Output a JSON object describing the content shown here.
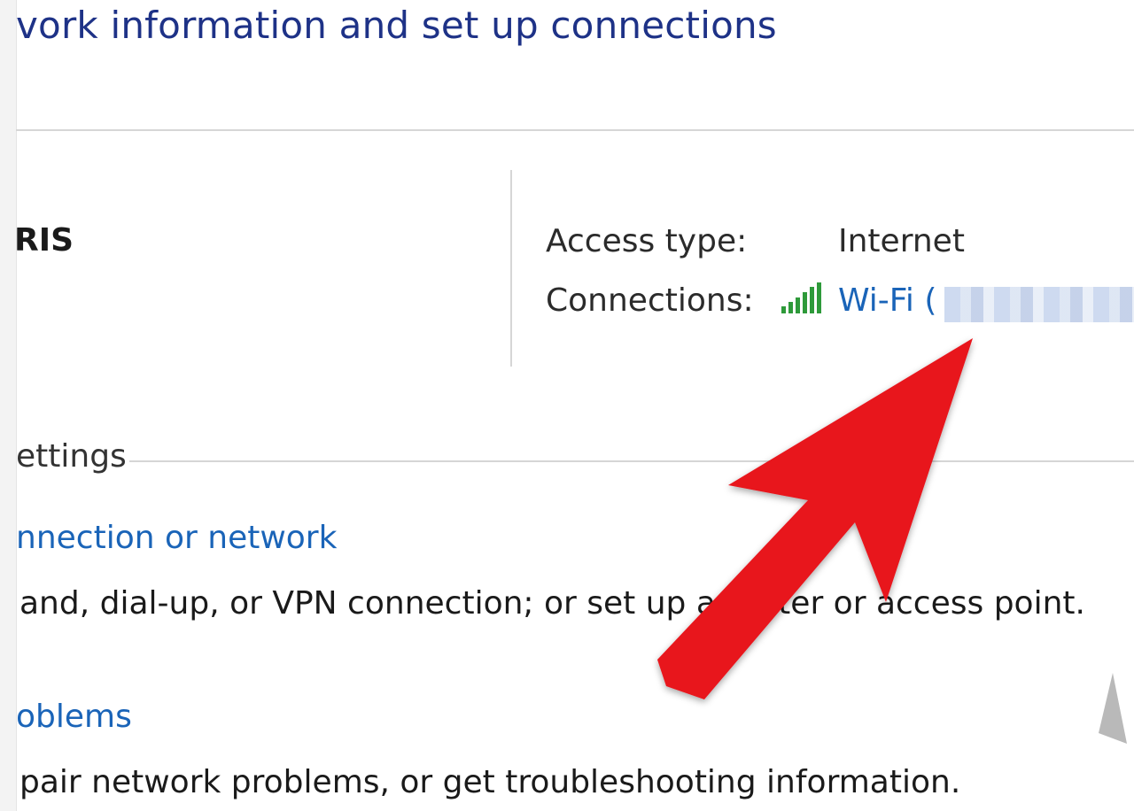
{
  "title": "vork information and set up connections",
  "network": {
    "name": "RIS"
  },
  "details": {
    "access_type_label": "Access type:",
    "access_type_value": "Internet",
    "connections_label": "Connections:",
    "connections_link": "Wi-Fi ("
  },
  "settings": {
    "heading": "ettings",
    "tasks": [
      {
        "link": "nnection or network",
        "desc": "and, dial-up, or VPN connection; or set up a router or access point."
      },
      {
        "link": "oblems",
        "desc": "pair network problems, or get troubleshooting information."
      }
    ]
  },
  "colors": {
    "title": "#1e3287",
    "link": "#1a64b8",
    "arrow": "#e8121b",
    "signal": "#2e9a3a"
  },
  "icons": {
    "signal": "wifi-signal-bars-icon",
    "annotation": "red-arrow-annotation"
  }
}
